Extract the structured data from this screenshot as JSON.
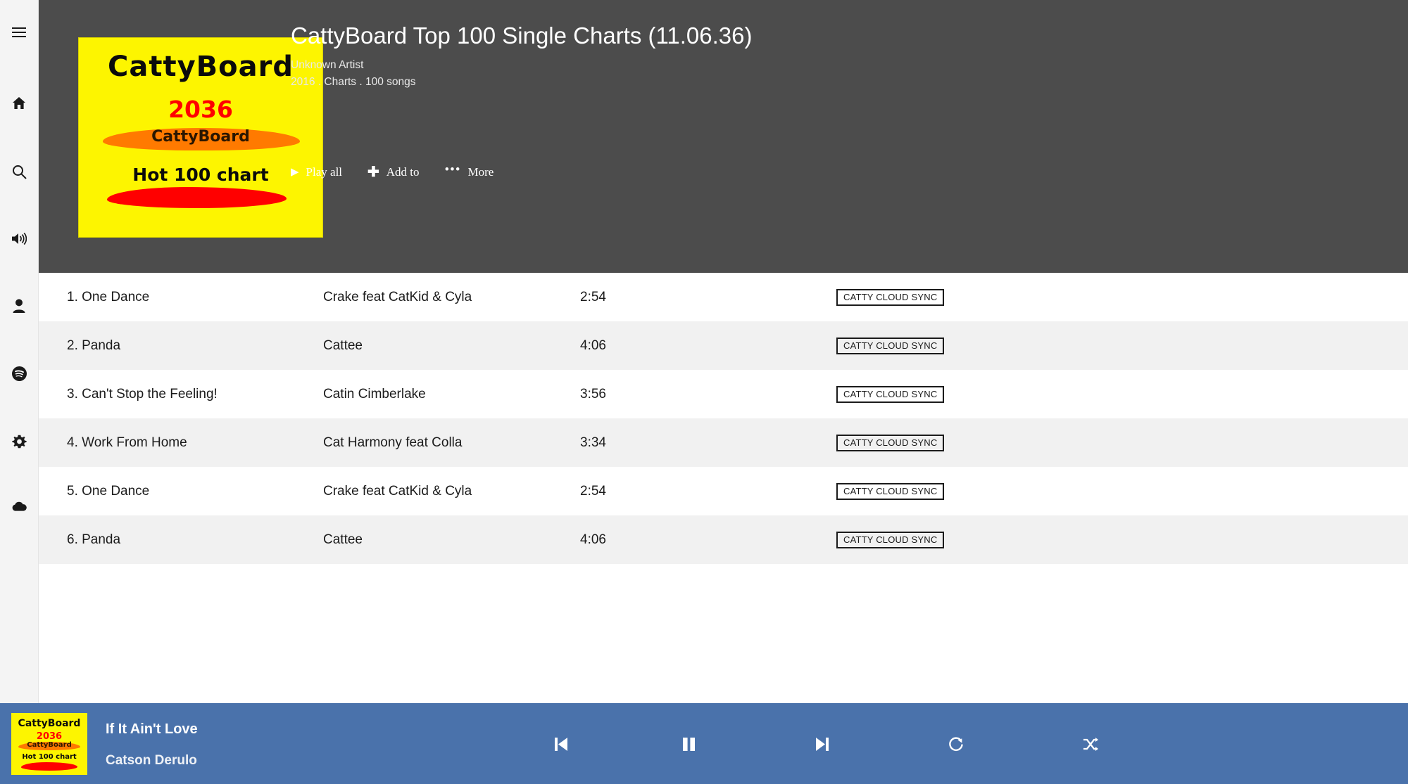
{
  "sidebar": {
    "items": [
      {
        "name": "menu",
        "icon": "hamburger-menu-icon",
        "label": "Menu"
      },
      {
        "name": "home",
        "icon": "home-icon",
        "label": "Home"
      },
      {
        "name": "search",
        "icon": "search-icon",
        "label": "Search"
      },
      {
        "name": "volume",
        "icon": "speaker-volume-icon",
        "label": "Volume"
      },
      {
        "name": "account",
        "icon": "user-account-icon",
        "label": "Account"
      },
      {
        "name": "spotify",
        "icon": "spotify-icon",
        "label": "Spotify"
      },
      {
        "name": "settings",
        "icon": "gear-icon",
        "label": "Settings"
      },
      {
        "name": "cloud",
        "icon": "cloud-icon",
        "label": "Cloud"
      }
    ]
  },
  "header": {
    "cover": {
      "title": "CattyBoard",
      "year": "2036",
      "subtitle": "CattyBoard",
      "tagline": "Hot 100 chart"
    },
    "title": "CattyBoard Top 100 Single Charts (11.06.36)",
    "artist": "Unknown Artist",
    "meta": "2016 . Charts . 100 songs",
    "actions": [
      {
        "label": "Play all",
        "icon": "play-icon",
        "glyph": "▶"
      },
      {
        "label": "Add to",
        "icon": "plus-icon",
        "glyph": "✚"
      },
      {
        "label": "More",
        "icon": "ellipsis-icon",
        "glyph": "•••"
      }
    ]
  },
  "tracks": {
    "badge_label": "CATTY CLOUD SYNC",
    "rows": [
      {
        "title": "1. One Dance",
        "artist": "Crake feat CatKid & Cyla",
        "duration": "2:54"
      },
      {
        "title": "2. Panda",
        "artist": "Cattee",
        "duration": "4:06"
      },
      {
        "title": "3. Can't Stop the Feeling!",
        "artist": "Catin Cimberlake",
        "duration": "3:56"
      },
      {
        "title": "4. Work From Home",
        "artist": "Cat Harmony feat Colla",
        "duration": "3:34"
      },
      {
        "title": "5. One Dance",
        "artist": "Crake feat CatKid & Cyla",
        "duration": "2:54"
      },
      {
        "title": "6. Panda",
        "artist": "Cattee",
        "duration": "4:06"
      }
    ]
  },
  "player": {
    "cover": {
      "title": "CattyBoard",
      "year": "2036",
      "subtitle": "CattyBoard",
      "tagline": "Hot 100 chart"
    },
    "song": "If It Ain't Love",
    "artist": "Catson Derulo",
    "controls": [
      {
        "name": "previous",
        "icon": "skip-previous-icon"
      },
      {
        "name": "pause",
        "icon": "pause-icon"
      },
      {
        "name": "next",
        "icon": "skip-next-icon"
      },
      {
        "name": "repeat",
        "icon": "repeat-icon"
      },
      {
        "name": "shuffle",
        "icon": "shuffle-icon"
      }
    ]
  },
  "colors": {
    "hero_bg": "#4c4c4c",
    "player_bg": "#4a72ab",
    "rail_bg": "#f4f4f4",
    "row_alt_bg": "#f1f1f1",
    "cover_yellow": "#fdf500",
    "cover_red": "#ff0000",
    "cover_orange": "#ff7a00"
  }
}
